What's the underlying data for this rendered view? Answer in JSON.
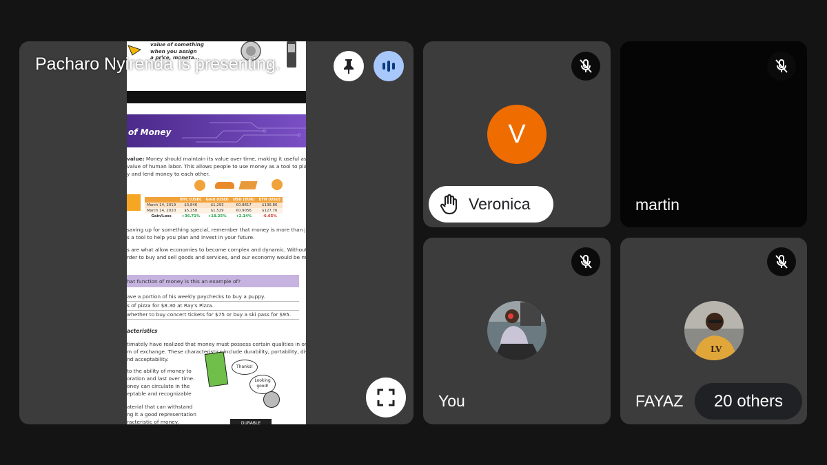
{
  "presentation": {
    "presenter_label": "Pacharo Nyirenda is presenting.",
    "pin_icon": "pin-icon",
    "audio_icon": "audio-level-icon",
    "fullscreen_icon": "fullscreen-icon",
    "doc": {
      "top_note": [
        "value of something",
        "when you assign",
        "a price, moneta..."
      ],
      "banner_title": "of Money",
      "para1": [
        {
          "bold": "value:",
          "text": " Money should maintain its value over time, making it useful as a way to"
        },
        {
          "bold": "",
          "text": "value of human labor. This allows people to use money as a tool to plan for the"
        },
        {
          "bold": "",
          "text": "y and lend money to each other."
        }
      ],
      "table": {
        "headers": [
          "",
          "BTC (USD)",
          "Gold (USD)",
          "USD (EUR)",
          "ETH (USD)"
        ],
        "rows": [
          [
            "March 14, 2019",
            "$3,846",
            "$1,293",
            "€0.8817",
            "$136.86"
          ],
          [
            "March 14, 2020",
            "$5,258",
            "$1,529",
            "€0.9056",
            "$127.76"
          ],
          [
            "Gain/Loss",
            "+36.71%",
            "+18.25%",
            "+2.14%",
            "-6.65%"
          ]
        ]
      },
      "para2": [
        "saving up for something special, remember that money is more than just a way",
        "s a tool to help you plan and invest in your future."
      ],
      "para3": [
        "s are what allow economies to become complex and dynamic. Without money,",
        "rder to buy and sell goods and services, and our economy would be much less"
      ],
      "quiz_title": "hat function of money is this an example of?",
      "quiz_items": [
        "ave a portion of his weekly paychecks to buy a puppy.",
        "s of pizza for $8.30 at Ray's Pizza.",
        "whether to buy concert tickets for $75 or buy a ski pass for $95."
      ],
      "section_heading": "acteristics",
      "para4": [
        "timately have realized that money must possess certain qualities in order to be",
        "m of exchange. These characteristics include durability, portability, divisibility,",
        "nd acceptability."
      ],
      "para5": [
        "to the ability of money to",
        "oration and last over time.",
        "oney can circulate in the",
        "eptable and recognizable"
      ],
      "para6": [
        "aterial that can withstand",
        "ng it a good representation",
        "racteristic of money."
      ],
      "bubble1": "Thanks!",
      "bubble2": "Looking good!",
      "durable_label": "DURABLE"
    }
  },
  "participants": {
    "veronica": {
      "initial": "V",
      "name": "Veronica",
      "avatar_color": "#ef6c00",
      "hand_icon": "raised-hand-icon",
      "mic_icon": "mic-off-icon"
    },
    "martin": {
      "name": "martin",
      "mic_icon": "mic-off-icon"
    },
    "you": {
      "name": "You",
      "mic_icon": "mic-off-icon",
      "avatar_icon": "avatar-photo"
    },
    "fayaz": {
      "name": "FAYAZ",
      "mic_icon": "mic-off-icon",
      "avatar_icon": "avatar-photo",
      "others_label": "20 others"
    }
  }
}
